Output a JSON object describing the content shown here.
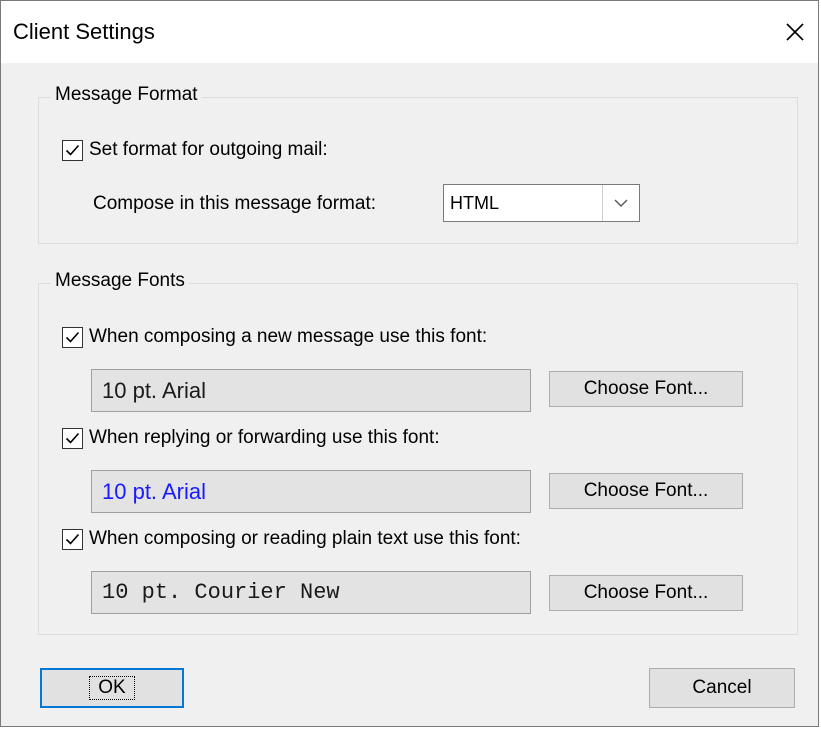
{
  "window": {
    "title": "Client Settings"
  },
  "message_format": {
    "group_label": "Message Format",
    "set_format_checkbox": {
      "label": "Set format for outgoing mail:",
      "checked": true
    },
    "compose_label": "Compose in this message format:",
    "compose_select": {
      "value": "HTML"
    }
  },
  "message_fonts": {
    "group_label": "Message Fonts",
    "new_message": {
      "checkbox_label": "When composing a new message use this font:",
      "checked": true,
      "font": "10 pt. Arial",
      "font_color": "#1a1a1a",
      "button_label": "Choose Font..."
    },
    "reply_forward": {
      "checkbox_label": "When replying or forwarding use this font:",
      "checked": true,
      "font": "10 pt. Arial",
      "font_color": "#1a1aff",
      "button_label": "Choose Font..."
    },
    "plain_text": {
      "checkbox_label": "When composing or reading plain text use this font:",
      "checked": true,
      "font": "10 pt. Courier New",
      "font_color": "#1a1a1a",
      "button_label": "Choose Font..."
    }
  },
  "buttons": {
    "ok": "OK",
    "cancel": "Cancel"
  },
  "colors": {
    "dialog_bg": "#f0f0f0",
    "titlebar_bg": "#ffffff",
    "default_button_border": "#0078d7"
  },
  "icons": {
    "close": "close-icon",
    "checkmark": "checkmark-icon",
    "dropdown": "chevron-down-icon"
  }
}
